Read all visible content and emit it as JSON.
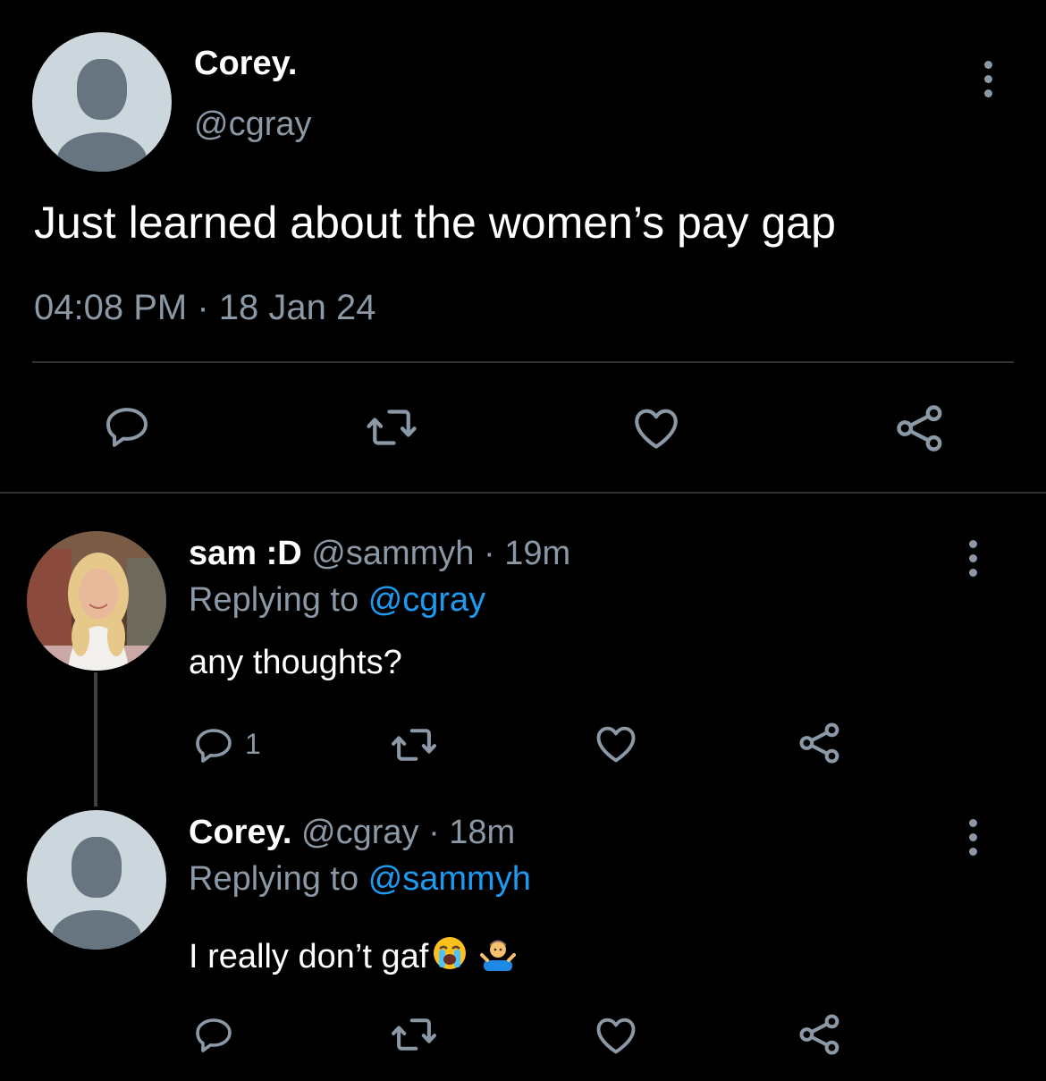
{
  "main_tweet": {
    "author_name": "Corey.",
    "handle": "@cgray",
    "text": "Just learned about the women’s pay gap",
    "timestamp": "04:08 PM · 18 Jan 24",
    "actions": [
      "reply-icon",
      "retweet-icon",
      "like-icon",
      "share-icon"
    ]
  },
  "replies": [
    {
      "author_name": "sam :D",
      "handle": "@sammyh",
      "time": "· 19m",
      "replying_prefix": "Replying to",
      "replying_to": "@cgray",
      "text": "any thoughts?",
      "reply_count": "1"
    },
    {
      "author_name": "Corey.",
      "handle": "@cgray",
      "time": "· 18m",
      "replying_prefix": "Replying to",
      "replying_to": "@sammyh",
      "text": "I really don’t gaf",
      "emojis": [
        "loudly-crying-face",
        "person-shrugging"
      ]
    }
  ],
  "colors": {
    "background": "#000000",
    "muted": "#8b98a5",
    "link": "#1d9bf0",
    "divider": "#2f3336"
  }
}
